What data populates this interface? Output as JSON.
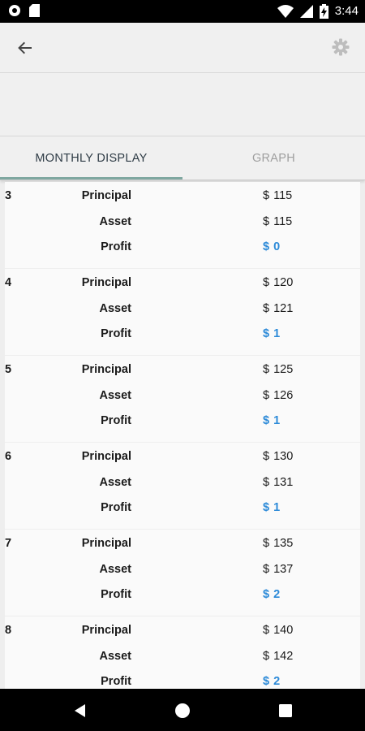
{
  "status_bar": {
    "time": "3:44",
    "icons": [
      "circle-notification-icon",
      "sd-card-icon",
      "wifi-icon",
      "cell-signal-icon",
      "battery-charging-icon"
    ]
  },
  "app_bar": {
    "back_icon": "arrow-back-icon",
    "settings_icon": "gear-icon"
  },
  "tabs": [
    {
      "label": "MONTHLY DISPLAY",
      "selected": true
    },
    {
      "label": "GRAPH",
      "selected": false
    }
  ],
  "colors": {
    "profit": "#2c8ad8",
    "tab_indicator": "#7fa7a0"
  },
  "rows": [
    {
      "month": "3",
      "principal_label": "Principal",
      "principal_currency": "$",
      "principal": "115",
      "asset_label": "Asset",
      "asset_currency": "$",
      "asset": "115",
      "profit_label": "Profit",
      "profit_currency": "$",
      "profit": "0"
    },
    {
      "month": "4",
      "principal_label": "Principal",
      "principal_currency": "$",
      "principal": "120",
      "asset_label": "Asset",
      "asset_currency": "$",
      "asset": "121",
      "profit_label": "Profit",
      "profit_currency": "$",
      "profit": "1"
    },
    {
      "month": "5",
      "principal_label": "Principal",
      "principal_currency": "$",
      "principal": "125",
      "asset_label": "Asset",
      "asset_currency": "$",
      "asset": "126",
      "profit_label": "Profit",
      "profit_currency": "$",
      "profit": "1"
    },
    {
      "month": "6",
      "principal_label": "Principal",
      "principal_currency": "$",
      "principal": "130",
      "asset_label": "Asset",
      "asset_currency": "$",
      "asset": "131",
      "profit_label": "Profit",
      "profit_currency": "$",
      "profit": "1"
    },
    {
      "month": "7",
      "principal_label": "Principal",
      "principal_currency": "$",
      "principal": "135",
      "asset_label": "Asset",
      "asset_currency": "$",
      "asset": "137",
      "profit_label": "Profit",
      "profit_currency": "$",
      "profit": "2"
    },
    {
      "month": "8",
      "principal_label": "Principal",
      "principal_currency": "$",
      "principal": "140",
      "asset_label": "Asset",
      "asset_currency": "$",
      "asset": "142",
      "profit_label": "Profit",
      "profit_currency": "$",
      "profit": "2"
    }
  ],
  "nav_bar": {
    "icons": [
      "nav-back-icon",
      "nav-home-icon",
      "nav-recents-icon"
    ]
  }
}
